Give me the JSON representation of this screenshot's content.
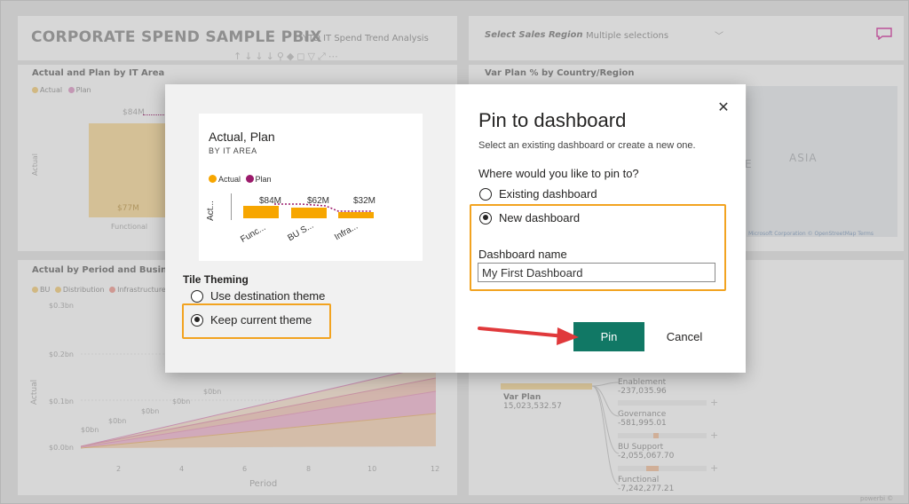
{
  "report": {
    "title": "CORPORATE SPEND SAMPLE PBIX",
    "subtitle": "YTD IT Spend Trend Analysis",
    "toolbar_glyphs": "↑↓↓↓⚲◆◻▽⤢⋯"
  },
  "slicer": {
    "label": "Select Sales Region",
    "value": "Multiple selections"
  },
  "bg_cards": {
    "actual_plan": {
      "title": "Actual and Plan by IT Area",
      "legend": [
        "Actual",
        "Plan"
      ],
      "value_top": "$84M",
      "value_bottom": "$77M",
      "axis_label": "Actual",
      "category": "Functional"
    },
    "map": {
      "title": "Var Plan % by Country/Region",
      "region_label": "ASIA",
      "partial_label": "E",
      "attribution": "Microsoft Corporation © OpenStreetMap Terms"
    },
    "period": {
      "title": "Actual by Period and Business",
      "legend": [
        "BU",
        "Distribution",
        "Infrastructure"
      ],
      "y_ticks": [
        "$0.3bn",
        "$0.2bn",
        "$0.1bn",
        "$0.0bn"
      ],
      "x_ticks": [
        "2",
        "4",
        "6",
        "8",
        "10",
        "12"
      ],
      "x_label": "Period",
      "y_label": "Actual",
      "point_labels": [
        "$0bn",
        "$0bn",
        "$0bn",
        "$0bn",
        "$0bn"
      ]
    },
    "sankey": {
      "root_label": "Var Plan",
      "root_value": "15,023,532.57",
      "nodes": [
        {
          "name": "Enablement",
          "value": "-237,035.96"
        },
        {
          "name": "Governance",
          "value": "-581,995.01"
        },
        {
          "name": "BU Support",
          "value": "-2,055,067.70"
        },
        {
          "name": "Functional",
          "value": "-7,242,277.21"
        }
      ]
    },
    "footer_brand": "powerbi ©"
  },
  "dialog": {
    "title": "Pin to dashboard",
    "subtitle": "Select an existing dashboard or create a new one.",
    "question": "Where would you like to pin to?",
    "options": {
      "existing": "Existing dashboard",
      "new": "New dashboard"
    },
    "selected_option": "new",
    "field_label": "Dashboard name",
    "field_value": "My First Dashboard",
    "pin_label": "Pin",
    "cancel_label": "Cancel",
    "close_glyph": "✕",
    "preview": {
      "title": "Actual, Plan",
      "subtitle": "BY IT AREA",
      "legend": [
        "Actual",
        "Plan"
      ],
      "axis_label": "Act...",
      "bar_labels": [
        "$84M",
        "$62M",
        "$32M"
      ],
      "categories": [
        "Func...",
        "BU S...",
        "Infra..."
      ]
    },
    "theming": {
      "heading": "Tile Theming",
      "options": [
        "Use destination theme",
        "Keep current theme"
      ],
      "selected": "Keep current theme"
    }
  },
  "colors": {
    "actual": "#f7a600",
    "plan": "#9b1a6b",
    "pin_button": "#117865",
    "highlight": "#f2a320",
    "arrow": "#e0393b",
    "comment_icon": "#d946a8"
  }
}
